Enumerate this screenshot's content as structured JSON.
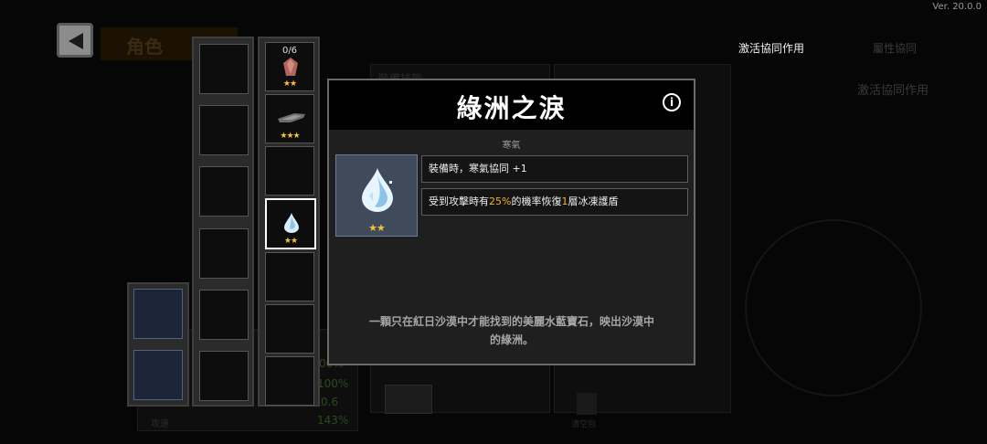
{
  "version": "Ver. 20.0.0",
  "header": {
    "title": "角色"
  },
  "tabs": {
    "activate_synergy": "激活協同作用",
    "attribute_synergy": "屬性協同",
    "activate_synergy_sub": "激活協同作用"
  },
  "background": {
    "equip_label": "裝備技能",
    "stats": [
      "00%",
      "100%",
      "0.6",
      "143%"
    ],
    "speed_label": "攻速",
    "trash_label": "清空包"
  },
  "slots": [
    {
      "count": "0/6",
      "stars": "★★",
      "icon": "red-gem-icon"
    },
    {
      "count": "",
      "stars": "★★★",
      "icon": "dagger-icon"
    },
    {
      "count": "",
      "stars": "",
      "icon": ""
    },
    {
      "count": "",
      "stars": "★★",
      "icon": "water-drop-icon",
      "selected": true
    }
  ],
  "popup": {
    "title": "綠洲之淚",
    "category": "寒氣",
    "item_stars": "★★",
    "effect1": "裝備時，寒氣協同 +1",
    "effect2_pre": "受到攻擊時有",
    "effect2_pct": "25%",
    "effect2_mid": "的機率恢復",
    "effect2_num": "1",
    "effect2_post": "層冰凍護盾",
    "description_line1": "一顆只在紅日沙漠中才能找到的美麗水藍寶石，映出沙漠中",
    "description_line2": "的綠洲。"
  },
  "colors": {
    "highlight": "#f0b429",
    "star": "#f4c232"
  }
}
